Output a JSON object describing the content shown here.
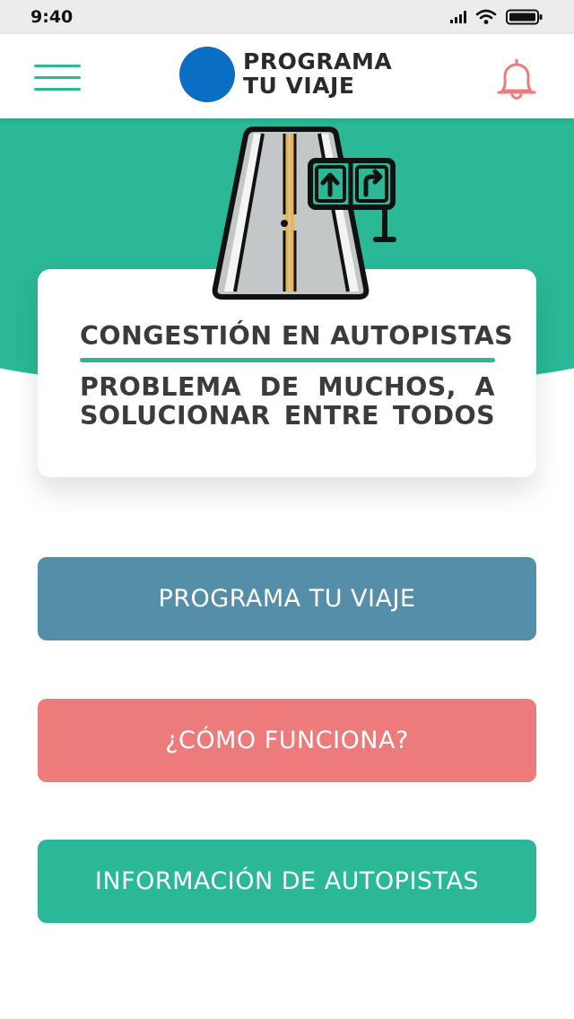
{
  "status_bar": {
    "time": "9:40"
  },
  "header": {
    "title_line1": "PROGRAMA",
    "title_line2": "TU VIAJE",
    "menu_icon": "hamburger-icon",
    "notification_icon": "bell-icon"
  },
  "hero": {
    "illustration": "highway-road-sign-icon"
  },
  "card": {
    "title": "CONGESTIÓN EN AUTOPISTAS",
    "subtitle": "PROBLEMA DE MUCHOS, A SOLUCIONAR ENTRE TODOS"
  },
  "buttons": {
    "plan_trip": "PROGRAMA TU VIAJE",
    "how_it_works": "¿CÓMO FUNCIONA?",
    "highway_info": "INFORMACIÓN DE AUTOPISTAS"
  },
  "colors": {
    "accent_green": "#2ab896",
    "logo_blue": "#0a6fc2",
    "button_blue": "#558ea9",
    "button_coral": "#ed7b7b",
    "bell": "#ed7b7b",
    "text_dark": "#3b3b3b"
  }
}
